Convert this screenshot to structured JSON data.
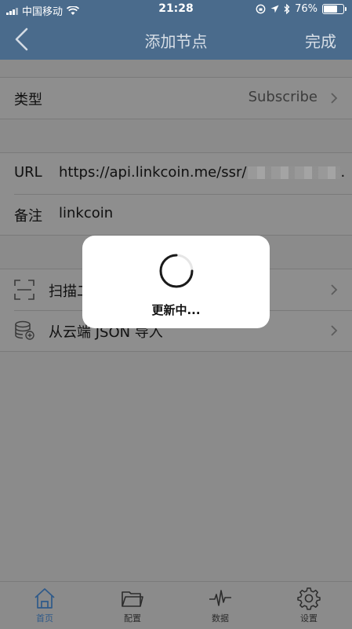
{
  "status": {
    "carrier": "中国移动",
    "time": "21:28",
    "battery": "76%",
    "battery_level": 0.76
  },
  "nav": {
    "title": "添加节点",
    "done": "完成"
  },
  "form": {
    "type_label": "类型",
    "type_value": "Subscribe",
    "url_label": "URL",
    "url_value": "https://api.linkcoin.me/ssr/",
    "url_suffix": ".",
    "note_label": "备注",
    "note_value": "linkcoin"
  },
  "actions": {
    "scan_label": "扫描二",
    "cloud_label": "从云端 JSON 导入"
  },
  "hud": {
    "message": "更新中..."
  },
  "tabs": [
    {
      "label": "首页",
      "icon": "home-icon",
      "active": true
    },
    {
      "label": "配置",
      "icon": "folder-icon",
      "active": false
    },
    {
      "label": "数据",
      "icon": "pulse-icon",
      "active": false
    },
    {
      "label": "设置",
      "icon": "gear-icon",
      "active": false
    }
  ],
  "colors": {
    "nav": "#4a6b8c",
    "active_tab": "#2f5a8a",
    "overlay_bg": "#8b8b8b"
  }
}
